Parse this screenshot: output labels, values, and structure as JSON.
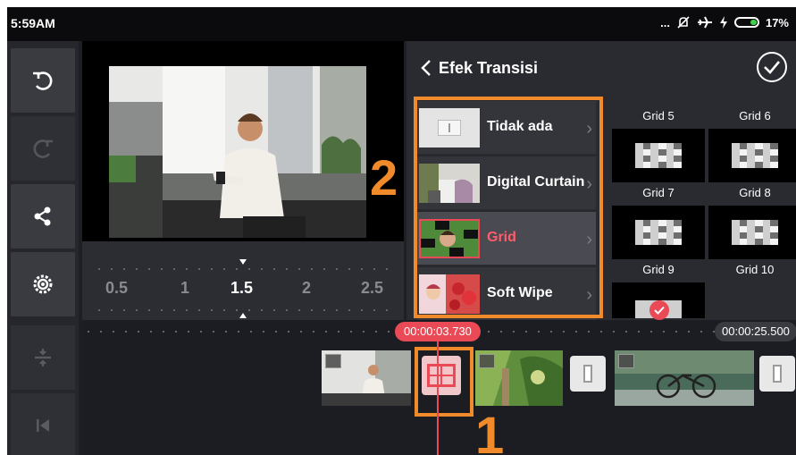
{
  "status_bar": {
    "time": "5:59AM",
    "battery": "17%",
    "icons": [
      "more-dots-icon",
      "mute-icon",
      "airplane-icon",
      "charging-icon",
      "battery-icon"
    ]
  },
  "toolbar": {
    "buttons": [
      "undo-icon",
      "redo-icon",
      "share-icon",
      "settings-icon",
      "split-icon",
      "skip-start-icon"
    ]
  },
  "speed_scale": {
    "labels": [
      "0.5",
      "1",
      "1.5",
      "2",
      "2.5"
    ],
    "selected": "1.5"
  },
  "panel": {
    "title": "Efek Transisi",
    "transitions": [
      {
        "label": "Tidak ada",
        "selected": false
      },
      {
        "label": "Digital Curtain",
        "selected": false
      },
      {
        "label": "Grid",
        "selected": true
      },
      {
        "label": "Soft Wipe",
        "selected": false
      }
    ],
    "grid_options": [
      "Grid 5",
      "Grid 6",
      "Grid 7",
      "Grid 8",
      "Grid 9",
      "Grid 10"
    ]
  },
  "timeline": {
    "playhead_time": "00:00:03.730",
    "end_time": "00:00:25.500"
  },
  "annotations": {
    "one": "1",
    "two": "2"
  },
  "colors": {
    "accent_red": "#e94a56",
    "annotation_orange": "#f08a2a",
    "panel_bg": "#2a2b31"
  }
}
